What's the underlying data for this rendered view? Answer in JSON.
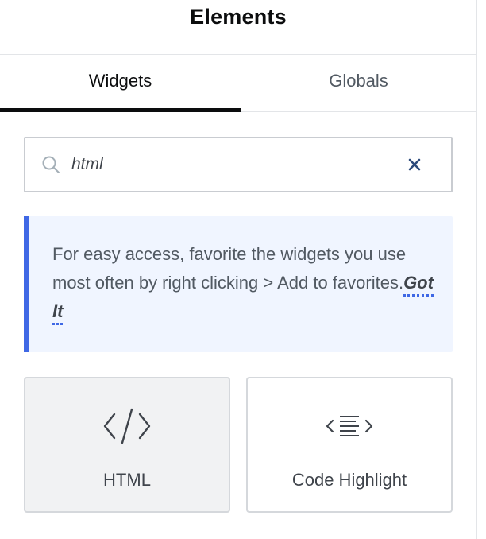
{
  "header": {
    "title": "Elements"
  },
  "tabs": [
    {
      "label": "Widgets",
      "active": true
    },
    {
      "label": "Globals",
      "active": false
    }
  ],
  "search": {
    "value": "html",
    "placeholder": ""
  },
  "notice": {
    "text": "For easy access, favorite the widgets you use most often by right clicking > Add to favorites.",
    "link_label": "Got It"
  },
  "widgets": [
    {
      "label": "HTML",
      "icon": "code-tag-icon"
    },
    {
      "label": "Code Highlight",
      "icon": "code-highlight-icon"
    }
  ],
  "colors": {
    "accent": "#3f68e5",
    "notice_bg": "#f0f5ff",
    "text": "#3f444b",
    "active_tab_underline": "#0c0d0e"
  }
}
